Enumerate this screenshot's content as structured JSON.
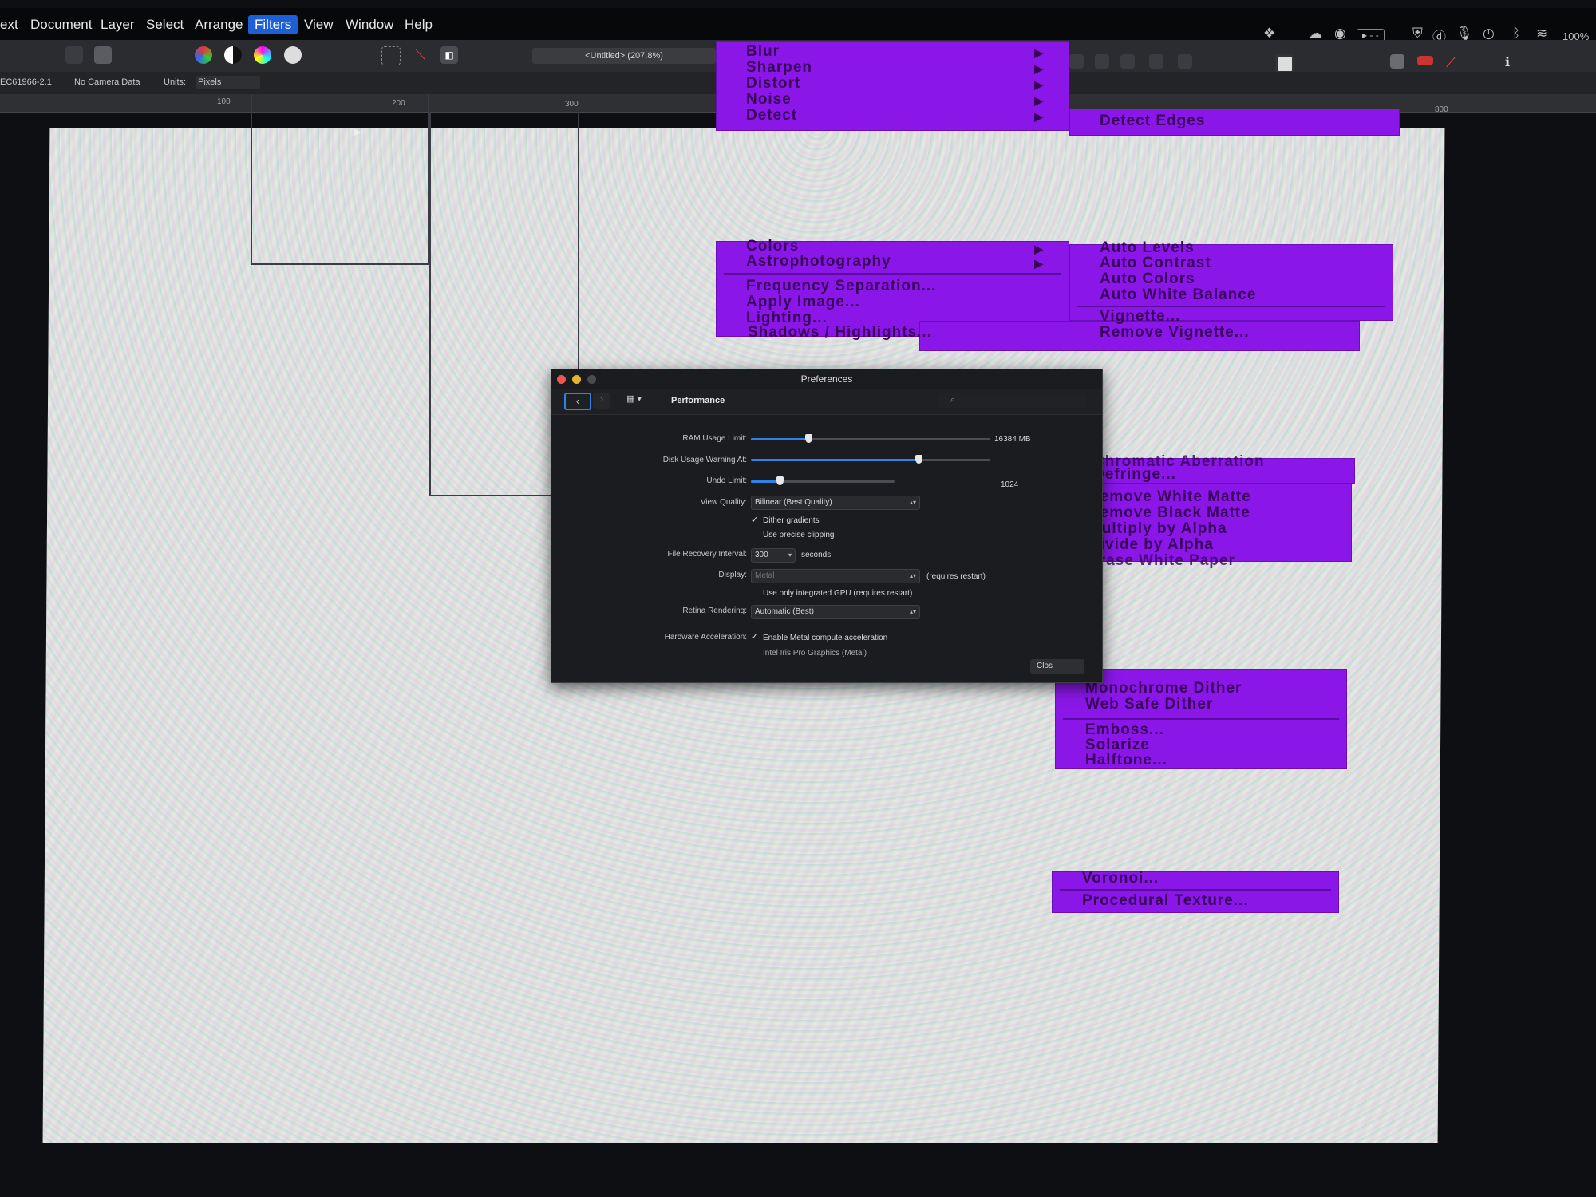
{
  "menubar": {
    "items": [
      "ext",
      "Document",
      "Layer",
      "Select",
      "Arrange",
      "Filters",
      "View",
      "Window",
      "Help"
    ],
    "battery": "100%"
  },
  "toolbar": {
    "doc_tab": "<Untitled> (207.8%)"
  },
  "context_bar": {
    "camera_id": "EC61966-2.1",
    "camera": "No Camera Data",
    "units_label": "Units:",
    "units_value": "Pixels"
  },
  "ruler": {
    "ticks": [
      "100",
      "200",
      "300",
      "800"
    ]
  },
  "filters_menu": {
    "top": [
      "Blur",
      "Sharpen",
      "Distort",
      "Noise",
      "Detect"
    ],
    "detect_submenu": [
      "Detect Edges"
    ],
    "middle": [
      "Colors",
      "Astrophotography",
      "Frequency Separation...",
      "Apply Image...",
      "Lighting...",
      "Shadows / Highlights..."
    ],
    "colors_submenu": [
      "Auto Levels",
      "Auto Contrast",
      "Auto Colors",
      "Auto White Balance",
      "Vignette...",
      "Remove Vignette..."
    ],
    "lens_submenu": [
      "Chromatic Aberration",
      "Defringe..."
    ],
    "matte_submenu": [
      "Remove White Matte",
      "Remove Black Matte",
      "Multiply by Alpha",
      "Divide by Alpha",
      "Erase White Paper"
    ],
    "dither_submenu": [
      "Monochrome Dither",
      "Web Safe Dither",
      "Emboss...",
      "Solarize",
      "Halftone..."
    ],
    "bottom": [
      "Voronoi...",
      "Procedural Texture..."
    ]
  },
  "preferences": {
    "title": "Preferences",
    "section": "Performance",
    "ram_label": "RAM Usage Limit:",
    "ram_value": "16384 MB",
    "ram_level": 0.24,
    "disk_label": "Disk Usage Warning At:",
    "disk_level": 0.7,
    "undo_label": "Undo Limit:",
    "undo_value": "1024",
    "undo_level": 0.2,
    "view_quality_label": "View Quality:",
    "view_quality_value": "Bilinear (Best Quality)",
    "dither_label": "Dither gradients",
    "clipping_label": "Use precise clipping",
    "recovery_label": "File Recovery Interval:",
    "recovery_value": "300",
    "recovery_unit": "seconds",
    "display_label": "Display:",
    "display_value": "Metal",
    "display_note": "(requires restart)",
    "gpu_label": "Use only integrated GPU (requires restart)",
    "retina_label": "Retina Rendering:",
    "retina_value": "Automatic (Best)",
    "hw_label": "Hardware Acceleration:",
    "hw_check_label": "Enable Metal compute acceleration",
    "hw_device": "Intel Iris Pro Graphics (Metal)",
    "close_label": "Clos"
  },
  "colors": {
    "menu_purple": "#8a17e8",
    "menu_text": "#3a005c",
    "selection_blue": "#1d5fd6",
    "slider_blue": "#2f83e8"
  }
}
